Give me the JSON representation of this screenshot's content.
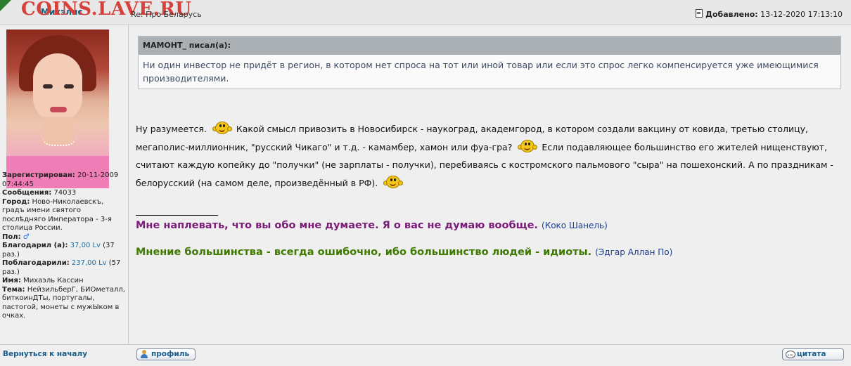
{
  "header": {
    "watermark": "COINS.LAVE.RU",
    "author": "Михэлис",
    "subject": "Re: Про Беларусь",
    "added_label": "Добавлено:",
    "added_value": "13-12-2020 17:13:10"
  },
  "profile": {
    "registered_label": "Зарегистрирован:",
    "registered_value": "20-11-2009 07:44:45",
    "messages_label": "Сообщения:",
    "messages_value": "74033",
    "city_label": "Город:",
    "city_value": "Ново-Николаевскъ, градъ имени святого послѣдняго Императора - 3-я столица России.",
    "gender_label": "Пол:",
    "gender_icon": "male-symbol-icon",
    "thanked_label": "Благодарил (а):",
    "thanked_value": "37,00 Lv",
    "thanked_times": "(37 раз.)",
    "thanked_by_label": "Поблагодарили:",
    "thanked_by_value": "237,00 Lv",
    "thanked_by_times": "(57 раз.)",
    "name_label": "Имя:",
    "name_value": "Михаэль Кассин",
    "topic_label": "Тема:",
    "topic_value": "НейзильберГ, БИОметалл, биткоинДТы, португалы, пастогой, монеты с мужЫком в очках."
  },
  "back_link": "Вернуться к началу",
  "quote": {
    "header": "МАМОНТ_ писал(а):",
    "text": "Ни один инвестор не придёт в регион, в котором нет спроса на тот или иной товар или если это спрос легко компенсируется уже имеющимися производителями."
  },
  "post": {
    "p1": "Ну разумеется.",
    "p2": "Какой смысл привозить в Новосибирск - наукоград, академгород, в котором создали вакцину от ковида, третью столицу, мегаполис-миллионник, \"русский Чикаго\" и т.д. - камамбер, хамон или фуа-гра?",
    "p3": "Если подавляющее большинство его жителей нищенствуют, считают каждую копейку до \"получки\" (не зарплаты - получки), перебиваясь с костромского пальмового \"сыра\" на пошехонский. А по праздникам - белорусский (на самом деле, произведённый в РФ).",
    "smiley_icon": "smiley-icon"
  },
  "signature": {
    "line1": "Мне наплевать, что вы обо мне думаете. Я о вас не думаю вообще.",
    "line1_attr": "(Коко Шанель)",
    "line2": "Мнение большинства - всегда ошибочно, ибо большинство людей - идиоты.",
    "line2_attr": "(Эдгар Аллан По)"
  },
  "buttons": {
    "profile": "профиль",
    "quote": "цитата"
  },
  "colors": {
    "watermark": "#D8413B",
    "signature1": "#7B1C78",
    "signature2": "#3F7A00",
    "quote_header_bg": "#A9AFB3"
  }
}
